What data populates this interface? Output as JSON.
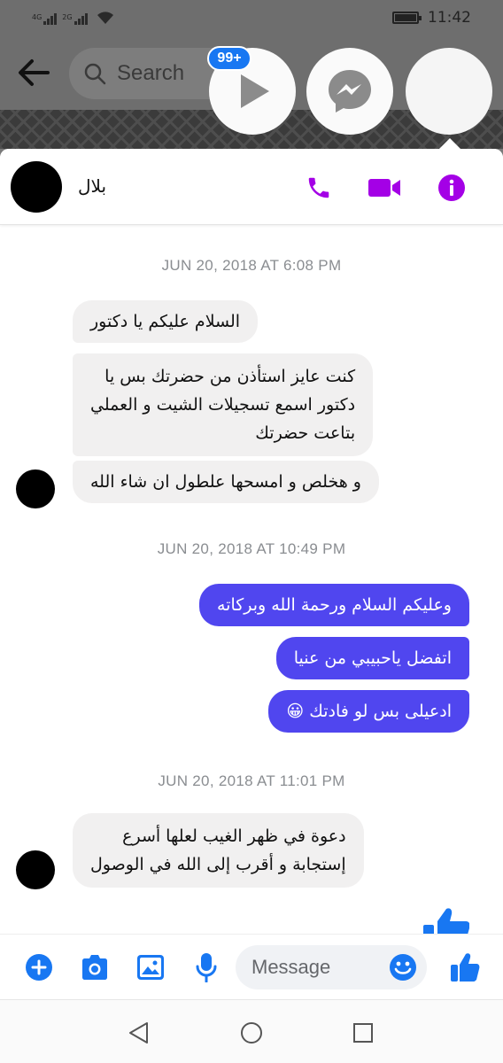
{
  "status_bar": {
    "sim1": "4G",
    "sim2": "2G",
    "time": "11:42"
  },
  "background_app": {
    "search_placeholder": "Search"
  },
  "chat_heads": {
    "badge": "99+"
  },
  "conversation": {
    "contact_name": "بلال",
    "header_icons": [
      "phone-icon",
      "video-camera-icon",
      "info-icon"
    ],
    "groups": [
      {
        "timestamp": "JUN 20, 2018 AT 6:08 PM",
        "messages": [
          {
            "direction": "incoming",
            "text": [
              "السلام عليكم يا دكتور"
            ]
          },
          {
            "direction": "incoming",
            "text": [
              "كنت عايز استأذن من حضرتك بس يا",
              "دكتور اسمع تسجيلات الشيت و العملي",
              "بتاعت حضرتك"
            ]
          },
          {
            "direction": "incoming",
            "text": [
              "و هخلص و امسحها علطول ان شاء الله"
            ]
          }
        ]
      },
      {
        "timestamp": "JUN 20, 2018 AT 10:49 PM",
        "messages": [
          {
            "direction": "outgoing",
            "text": [
              "وعليكم السلام ورحمة الله وبركاته"
            ]
          },
          {
            "direction": "outgoing",
            "text": [
              "اتفضل ياحبيبي من عنيا"
            ]
          },
          {
            "direction": "outgoing",
            "text": [
              "ادعيلى بس لو فادتك 😀"
            ]
          }
        ]
      },
      {
        "timestamp": "JUN 20, 2018 AT 11:01 PM",
        "messages": [
          {
            "direction": "incoming",
            "text": [
              "دعوة في ظهر الغيب لعلها أسرع",
              "إستجابة و أقرب إلى الله في الوصول"
            ]
          }
        ]
      }
    ]
  },
  "composer": {
    "placeholder": "Message",
    "icons": [
      "plus-icon",
      "camera-icon",
      "gallery-icon",
      "microphone-icon",
      "emoji-icon",
      "thumbs-up-icon"
    ]
  },
  "colors": {
    "accent": "#a400e6",
    "outgoing_bubble": "#5046ef",
    "incoming_bubble": "#f1f0f0",
    "messenger_blue": "#1877f2"
  }
}
